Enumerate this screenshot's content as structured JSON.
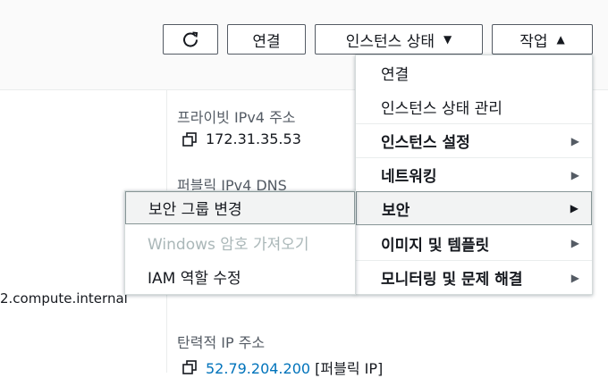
{
  "toolbar": {
    "refresh_icon": "refresh-icon",
    "connect_label": "연결",
    "instance_state_label": "인스턴스 상태",
    "actions_label": "작업",
    "caret_down": "▼",
    "caret_up": "▲"
  },
  "details": {
    "private_ipv4_label": "프라이빗 IPv4 주소",
    "private_ipv4_value": "172.31.35.53",
    "public_dns_label": "퍼블릭 IPv4 DNS",
    "internal_fragment": "2.compute.internal",
    "elastic_ip_label": "탄력적 IP 주소",
    "elastic_ip_value": "52.79.204.200",
    "elastic_ip_suffix": "[퍼블릭 IP]"
  },
  "actions_menu": {
    "items": [
      {
        "label": "연결"
      },
      {
        "label": "인스턴스 상태 관리"
      },
      {
        "label": "인스턴스 설정"
      },
      {
        "label": "네트워킹"
      },
      {
        "label": "보안"
      },
      {
        "label": "이미지 및 템플릿"
      },
      {
        "label": "모니터링 및 문제 해결"
      }
    ],
    "submenu_arrow": "▶"
  },
  "security_submenu": {
    "items": [
      {
        "label": "보안 그룹 변경",
        "state": "hover"
      },
      {
        "label": "Windows 암호 가져오기",
        "state": "disabled"
      },
      {
        "label": "IAM 역할 수정",
        "state": "enabled"
      }
    ]
  },
  "colors": {
    "link": "#0073bb",
    "disabled_text": "#aab7b8",
    "border": "#545b64"
  }
}
